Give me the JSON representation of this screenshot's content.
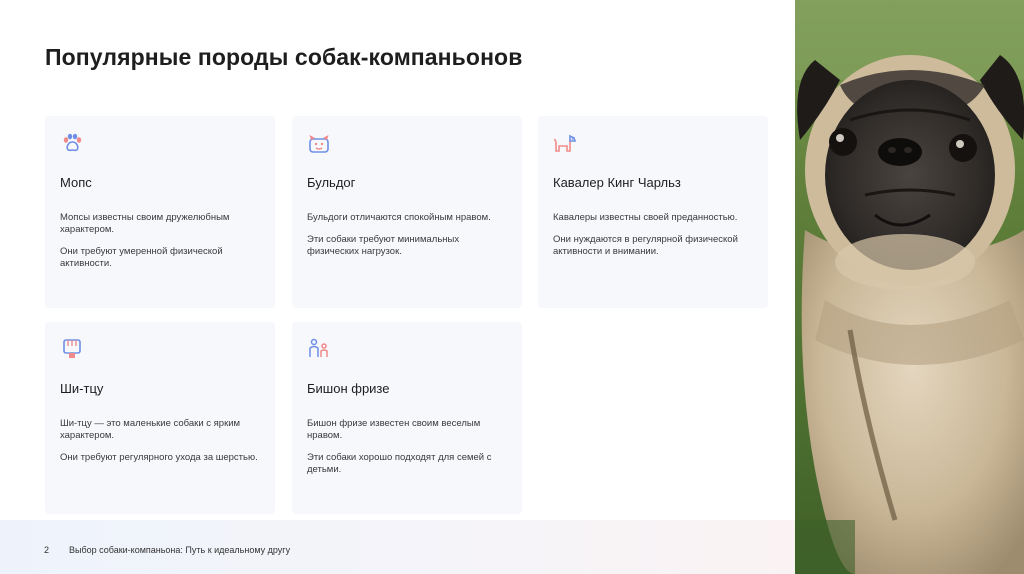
{
  "slide": {
    "title": "Популярные породы собак-компаньонов",
    "page_number": "2",
    "footer": "Выбор собаки-компаньона: Путь к идеальному другу"
  },
  "cards": [
    {
      "icon": "paw-icon",
      "name": "Мопс",
      "p1": "Мопсы известны своим дружелюбным характером.",
      "p2": "Они требуют умеренной физической активности."
    },
    {
      "icon": "dog-bulldog-icon",
      "name": "Бульдог",
      "p1": "Бульдоги отличаются спокойным нравом.",
      "p2": "Эти собаки требуют минимальных физических нагрузок."
    },
    {
      "icon": "dog-cavalier-icon",
      "name": "Кавалер Кинг Чарльз",
      "p1": "Кавалеры известны своей преданностью.",
      "p2": "Они нуждаются в регулярной физической активности и внимании."
    },
    {
      "icon": "grooming-icon",
      "name": "Ши-тцу",
      "p1": "Ши-тцу — это маленькие собаки с ярким характером.",
      "p2": "Они требуют регулярного ухода за шерстью."
    },
    {
      "icon": "family-icon",
      "name": "Бишон фризе",
      "p1": "Бишон фризе известен своим веселым нравом.",
      "p2": "Эти собаки хорошо подходят для семей с детьми."
    }
  ],
  "colors": {
    "icon_blue": "#6f8fe6",
    "icon_pink": "#f08a8a",
    "card_bg": "#f7f8fc"
  }
}
